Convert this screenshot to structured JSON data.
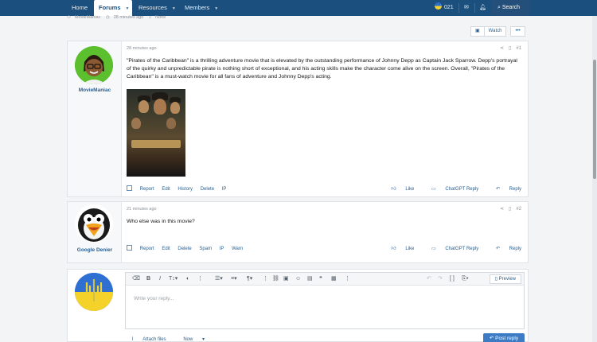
{
  "nav": {
    "items": [
      {
        "label": "Home"
      },
      {
        "label": "Forums"
      },
      {
        "label": "Resources"
      },
      {
        "label": "Members"
      }
    ],
    "user_badge": "021",
    "search_label": "Search"
  },
  "thread_meta": {
    "author": "MovieManiac",
    "time": "28 minutes ago",
    "tags": "None"
  },
  "watch_label": "Watch",
  "dots_label": "•••",
  "posts": [
    {
      "username": "MovieManiac",
      "time": "28 minutes ago",
      "number": "#1",
      "text": "\"Pirates of the Caribbean\" is a thrilling adventure movie that is elevated by the outstanding performance of Johnny Depp as Captain Jack Sparrow. Depp's portrayal of the quirky and unpredictable pirate is nothing short of exceptional, and his acting skills make the character come alive on the screen. Overall, \"Pirates of the Caribbean\" is a must-watch movie for all fans of adventure and Johnny Depp's acting.",
      "actions_left": [
        "Report",
        "Edit",
        "History",
        "Delete",
        "IP"
      ],
      "actions_right": [
        "Like",
        "ChatGPT Reply",
        "Reply"
      ]
    },
    {
      "username": "Google Denier",
      "time": "21 minutes ago",
      "number": "#2",
      "text": "Who else was in this movie?",
      "actions_left": [
        "Report",
        "Edit",
        "Delete",
        "Spam",
        "IP",
        "Warn"
      ],
      "actions_right": [
        "Like",
        "ChatGPT Reply",
        "Reply"
      ]
    }
  ],
  "reply": {
    "placeholder": "Write your reply...",
    "preview_label": "Preview",
    "attach_label": "Attach files",
    "now_label": "Now",
    "post_reply_label": "Post reply"
  },
  "colors": {
    "nav_bg": "#1b4f7d",
    "link": "#2c5f8d",
    "primary_button": "#3d7cc5"
  }
}
